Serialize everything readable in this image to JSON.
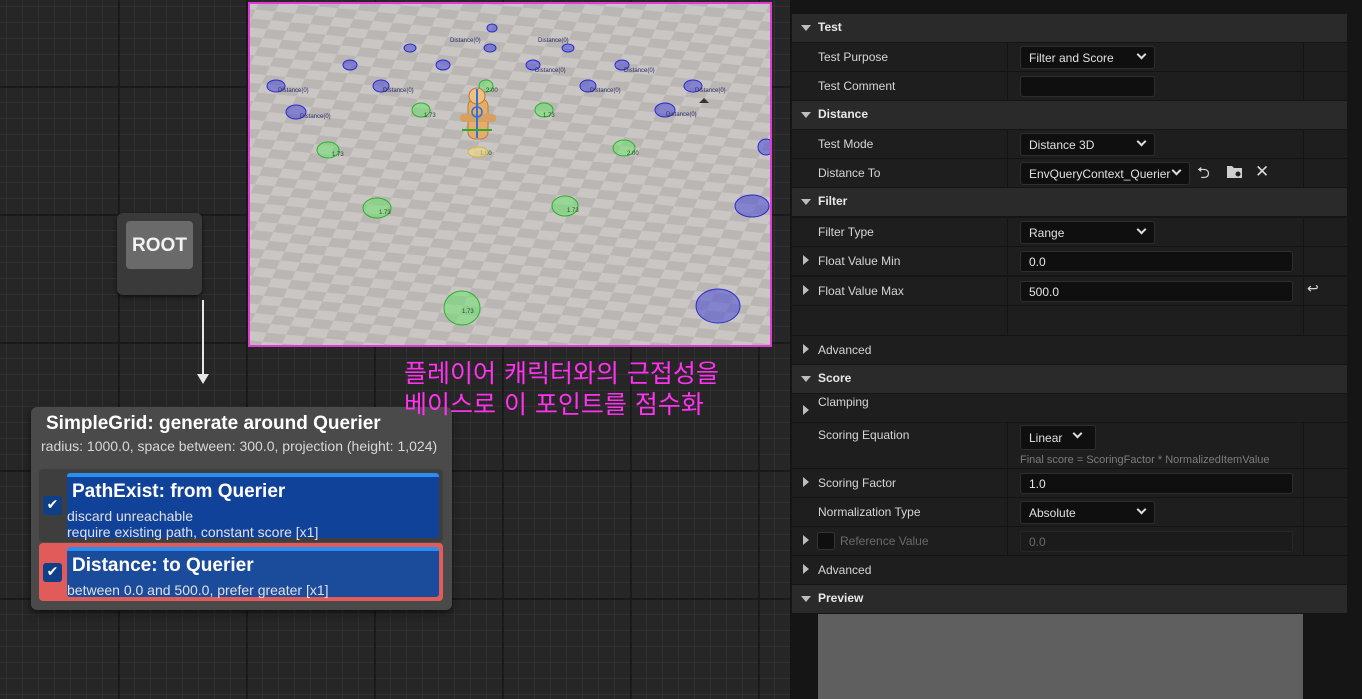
{
  "graph": {
    "root_label": "ROOT",
    "generator": {
      "title": "SimpleGrid: generate around Querier",
      "subtitle": "radius: 1000.0, space between: 300.0, projection (height: 1,024)"
    },
    "tests": [
      {
        "title": "PathExist: from Querier",
        "line1": "discard unreachable",
        "line2": "require existing path, constant score [x1]",
        "checked": true
      },
      {
        "title": "Distance: to Querier",
        "line1": "between 0.0 and 500.0, prefer greater [x1]",
        "checked": true
      }
    ]
  },
  "annotation": {
    "line1": "플레이어 캐릭터와의 근접성을",
    "line2": "베이스로 이 포인트를 점수화"
  },
  "viewport": {
    "blue_label": "Distance(0)",
    "scores": [
      "2.00",
      "1.73",
      "1.73",
      "2.00",
      "1.73",
      "1.73",
      "1.73",
      "1.73",
      "1.00"
    ]
  },
  "details": {
    "sections": {
      "test": "Test",
      "distance": "Distance",
      "filter": "Filter",
      "advanced1": "Advanced",
      "score": "Score",
      "advanced2": "Advanced",
      "preview": "Preview"
    },
    "test_purpose": {
      "label": "Test Purpose",
      "value": "Filter and Score"
    },
    "test_comment": {
      "label": "Test Comment",
      "value": ""
    },
    "test_mode": {
      "label": "Test Mode",
      "value": "Distance 3D"
    },
    "distance_to": {
      "label": "Distance To",
      "value": "EnvQueryContext_Querier"
    },
    "filter_type": {
      "label": "Filter Type",
      "value": "Range"
    },
    "float_min": {
      "label": "Float Value Min",
      "value": "0.0"
    },
    "float_max": {
      "label": "Float Value Max",
      "value": "500.0"
    },
    "clamping": {
      "label": "Clamping"
    },
    "scoring_equation": {
      "label": "Scoring Equation",
      "value": "Linear",
      "hint": "Final score = ScoringFactor * NormalizedItemValue"
    },
    "scoring_factor": {
      "label": "Scoring Factor",
      "value": "1.0"
    },
    "normalization_type": {
      "label": "Normalization Type",
      "value": "Absolute"
    },
    "reference_value": {
      "label": "Reference Value",
      "value": "0.0"
    }
  },
  "icons": [
    "back-arrow-icon",
    "browse-folder-icon",
    "clear-x-icon",
    "reset-arrow-icon",
    "checkmark-icon"
  ],
  "colors": {
    "accent_magenta": "#e23ad8",
    "test_blue": "#11429a",
    "selected_red": "#e25b5b"
  }
}
